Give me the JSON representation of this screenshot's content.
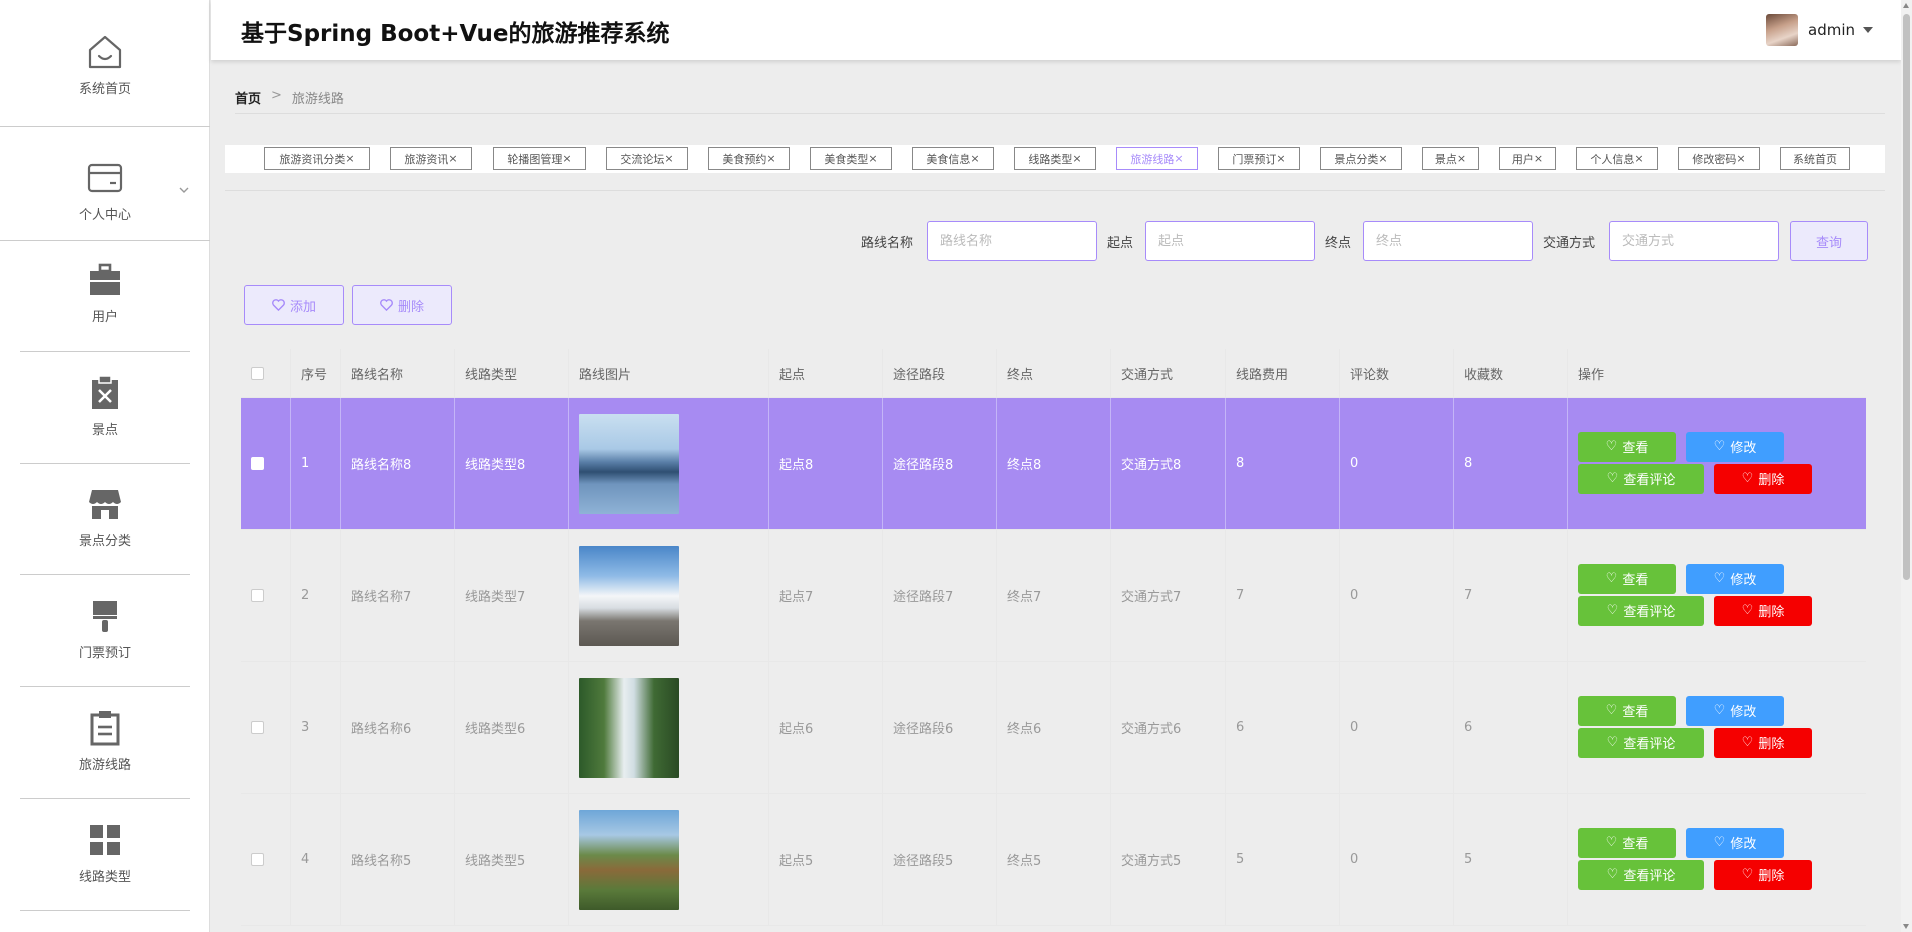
{
  "app": {
    "title": "基于Spring Boot+Vue的旅游推荐系统"
  },
  "user": {
    "name": "admin"
  },
  "sidebar": {
    "items": [
      {
        "label": "系统首页",
        "icon": "home-icon"
      },
      {
        "label": "个人中心",
        "icon": "wallet-icon"
      },
      {
        "label": "用户",
        "icon": "briefcase-icon"
      },
      {
        "label": "景点",
        "icon": "clipboard-x-icon"
      },
      {
        "label": "景点分类",
        "icon": "shop-icon"
      },
      {
        "label": "门票预订",
        "icon": "brush-icon"
      },
      {
        "label": "旅游线路",
        "icon": "clipboard-list-icon"
      },
      {
        "label": "线路类型",
        "icon": "grid-icon"
      }
    ]
  },
  "breadcrumb": {
    "home": "首页",
    "separator": ">",
    "current": "旅游线路"
  },
  "tags": [
    {
      "label": "旅游资讯分类",
      "active": false
    },
    {
      "label": "旅游资讯",
      "active": false
    },
    {
      "label": "轮播图管理",
      "active": false
    },
    {
      "label": "交流论坛",
      "active": false
    },
    {
      "label": "美食预约",
      "active": false
    },
    {
      "label": "美食类型",
      "active": false
    },
    {
      "label": "美食信息",
      "active": false
    },
    {
      "label": "线路类型",
      "active": false
    },
    {
      "label": "旅游线路",
      "active": true
    },
    {
      "label": "门票预订",
      "active": false
    },
    {
      "label": "景点分类",
      "active": false
    },
    {
      "label": "景点",
      "active": false
    },
    {
      "label": "用户",
      "active": false
    },
    {
      "label": "个人信息",
      "active": false
    },
    {
      "label": "修改密码",
      "active": false
    },
    {
      "label": "系统首页",
      "active": false
    }
  ],
  "search": {
    "route_label": "路线名称",
    "route_placeholder": "路线名称",
    "start_label": "起点",
    "start_placeholder": "起点",
    "end_label": "终点",
    "end_placeholder": "终点",
    "transport_label": "交通方式",
    "transport_placeholder": "交通方式",
    "query_button": "查询"
  },
  "actions": {
    "add": "添加",
    "delete": "删除"
  },
  "table": {
    "columns": [
      "序号",
      "路线名称",
      "线路类型",
      "路线图片",
      "起点",
      "途径路段",
      "终点",
      "交通方式",
      "线路费用",
      "评论数",
      "收藏数",
      "操作"
    ],
    "op_labels": {
      "view": "查看",
      "edit": "修改",
      "comments": "查看评论",
      "delete": "删除"
    },
    "rows": [
      {
        "index": "1",
        "name": "路线名称8",
        "type": "线路类型8",
        "image": "karst-lake-photo",
        "start": "起点8",
        "route": "途径路段8",
        "end": "终点8",
        "transport": "交通方式8",
        "fee": "8",
        "comments": "0",
        "favorites": "8",
        "selected": true
      },
      {
        "index": "2",
        "name": "路线名称7",
        "type": "线路类型7",
        "image": "mountain-clouds-photo",
        "start": "起点7",
        "route": "途径路段7",
        "end": "终点7",
        "transport": "交通方式7",
        "fee": "7",
        "comments": "0",
        "favorites": "7",
        "selected": false
      },
      {
        "index": "3",
        "name": "路线名称6",
        "type": "线路类型6",
        "image": "waterfall-photo",
        "start": "起点6",
        "route": "途径路段6",
        "end": "终点6",
        "transport": "交通方式6",
        "fee": "6",
        "comments": "0",
        "favorites": "6",
        "selected": false
      },
      {
        "index": "4",
        "name": "路线名称5",
        "type": "线路类型5",
        "image": "great-wall-photo",
        "start": "起点5",
        "route": "途径路段5",
        "end": "终点5",
        "transport": "交通方式5",
        "fee": "5",
        "comments": "0",
        "favorites": "5",
        "selected": false
      }
    ]
  },
  "colors": {
    "accent": "#a78bfa",
    "selected_row": "#a78bf2",
    "green": "#67c23a",
    "blue": "#409eff",
    "red": "#f50000"
  }
}
